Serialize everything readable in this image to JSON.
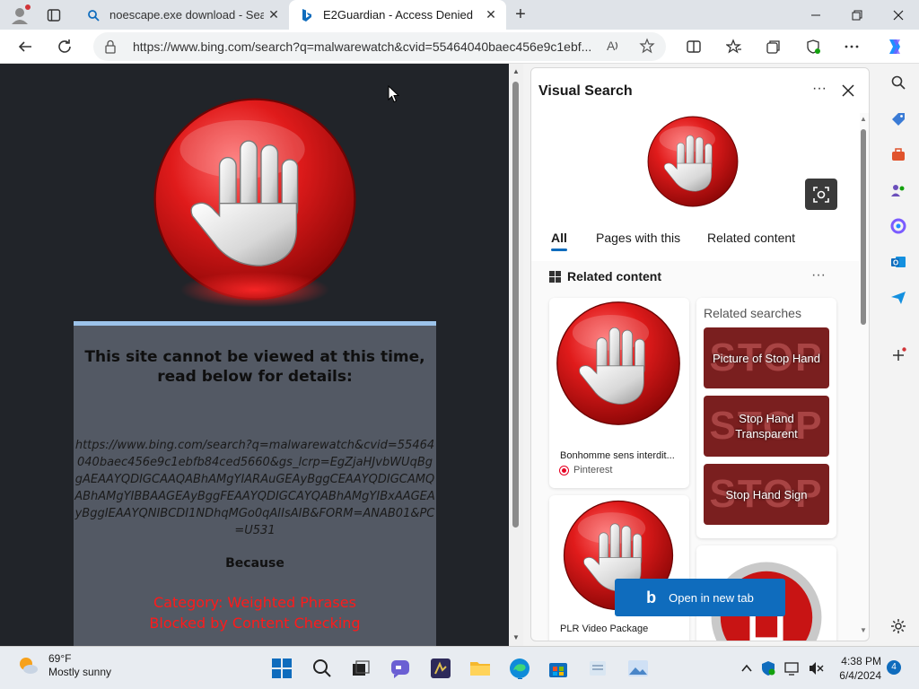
{
  "browser": {
    "tabs": [
      {
        "label": "noescape.exe download - Search",
        "active": false
      },
      {
        "label": "E2Guardian - Access Denied",
        "active": true
      }
    ],
    "url": "https://www.bing.com/search?q=malwarewatch&cvid=55464040baec456e9c1ebf..."
  },
  "blocked_page": {
    "title": "This site cannot be viewed at this time, read below for details:",
    "blocked_url": "https://www.bing.com/search?q=malwarewatch&cvid=55464040baec456e9c1ebfb84ced5660&gs_lcrp=EgZjaHJvbWUqBggAEAAYQDIGCAAQABhAMgYIARAuGEAyBggCEAAYQDIGCAMQABhAMgYIBBAAGEAyBggFEAAYQDIGCAYQABhAMgYIBxAAGEAyBggIEAAYQNIBCDI1NDhqMGo0qAIIsAIB&FORM=ANAB01&PC=U531",
    "because_label": "Because",
    "category_line": "Category: Weighted Phrases",
    "reason_line": "Blocked by Content Checking"
  },
  "visual_search": {
    "title": "Visual Search",
    "tabs": [
      {
        "label": "All",
        "active": true
      },
      {
        "label": "Pages with this",
        "active": false
      },
      {
        "label": "Related content",
        "active": false
      }
    ],
    "related_content_label": "Related content",
    "cards": [
      {
        "title": "Bonhomme sens interdit...",
        "source": "Pinterest"
      },
      {
        "title": "PLR Video Package",
        "source": ""
      }
    ],
    "related_searches_label": "Related searches",
    "related_searches": [
      {
        "label": "Picture of Stop Hand",
        "bg": "STOP"
      },
      {
        "label": "Stop Hand Transparent",
        "bg": "STOP"
      },
      {
        "label": "Stop Hand Sign",
        "bg": "STOP"
      }
    ],
    "open_button_label": "Open in new tab"
  },
  "taskbar": {
    "temperature": "69°F",
    "weather": "Mostly sunny",
    "time": "4:38 PM",
    "date": "6/4/2024",
    "notification_count": "4"
  },
  "colors": {
    "accent": "#0f6cbd",
    "stop_red": "#e01b1b",
    "blocked_text": "#ff1a1a",
    "page_bg": "#212429"
  }
}
